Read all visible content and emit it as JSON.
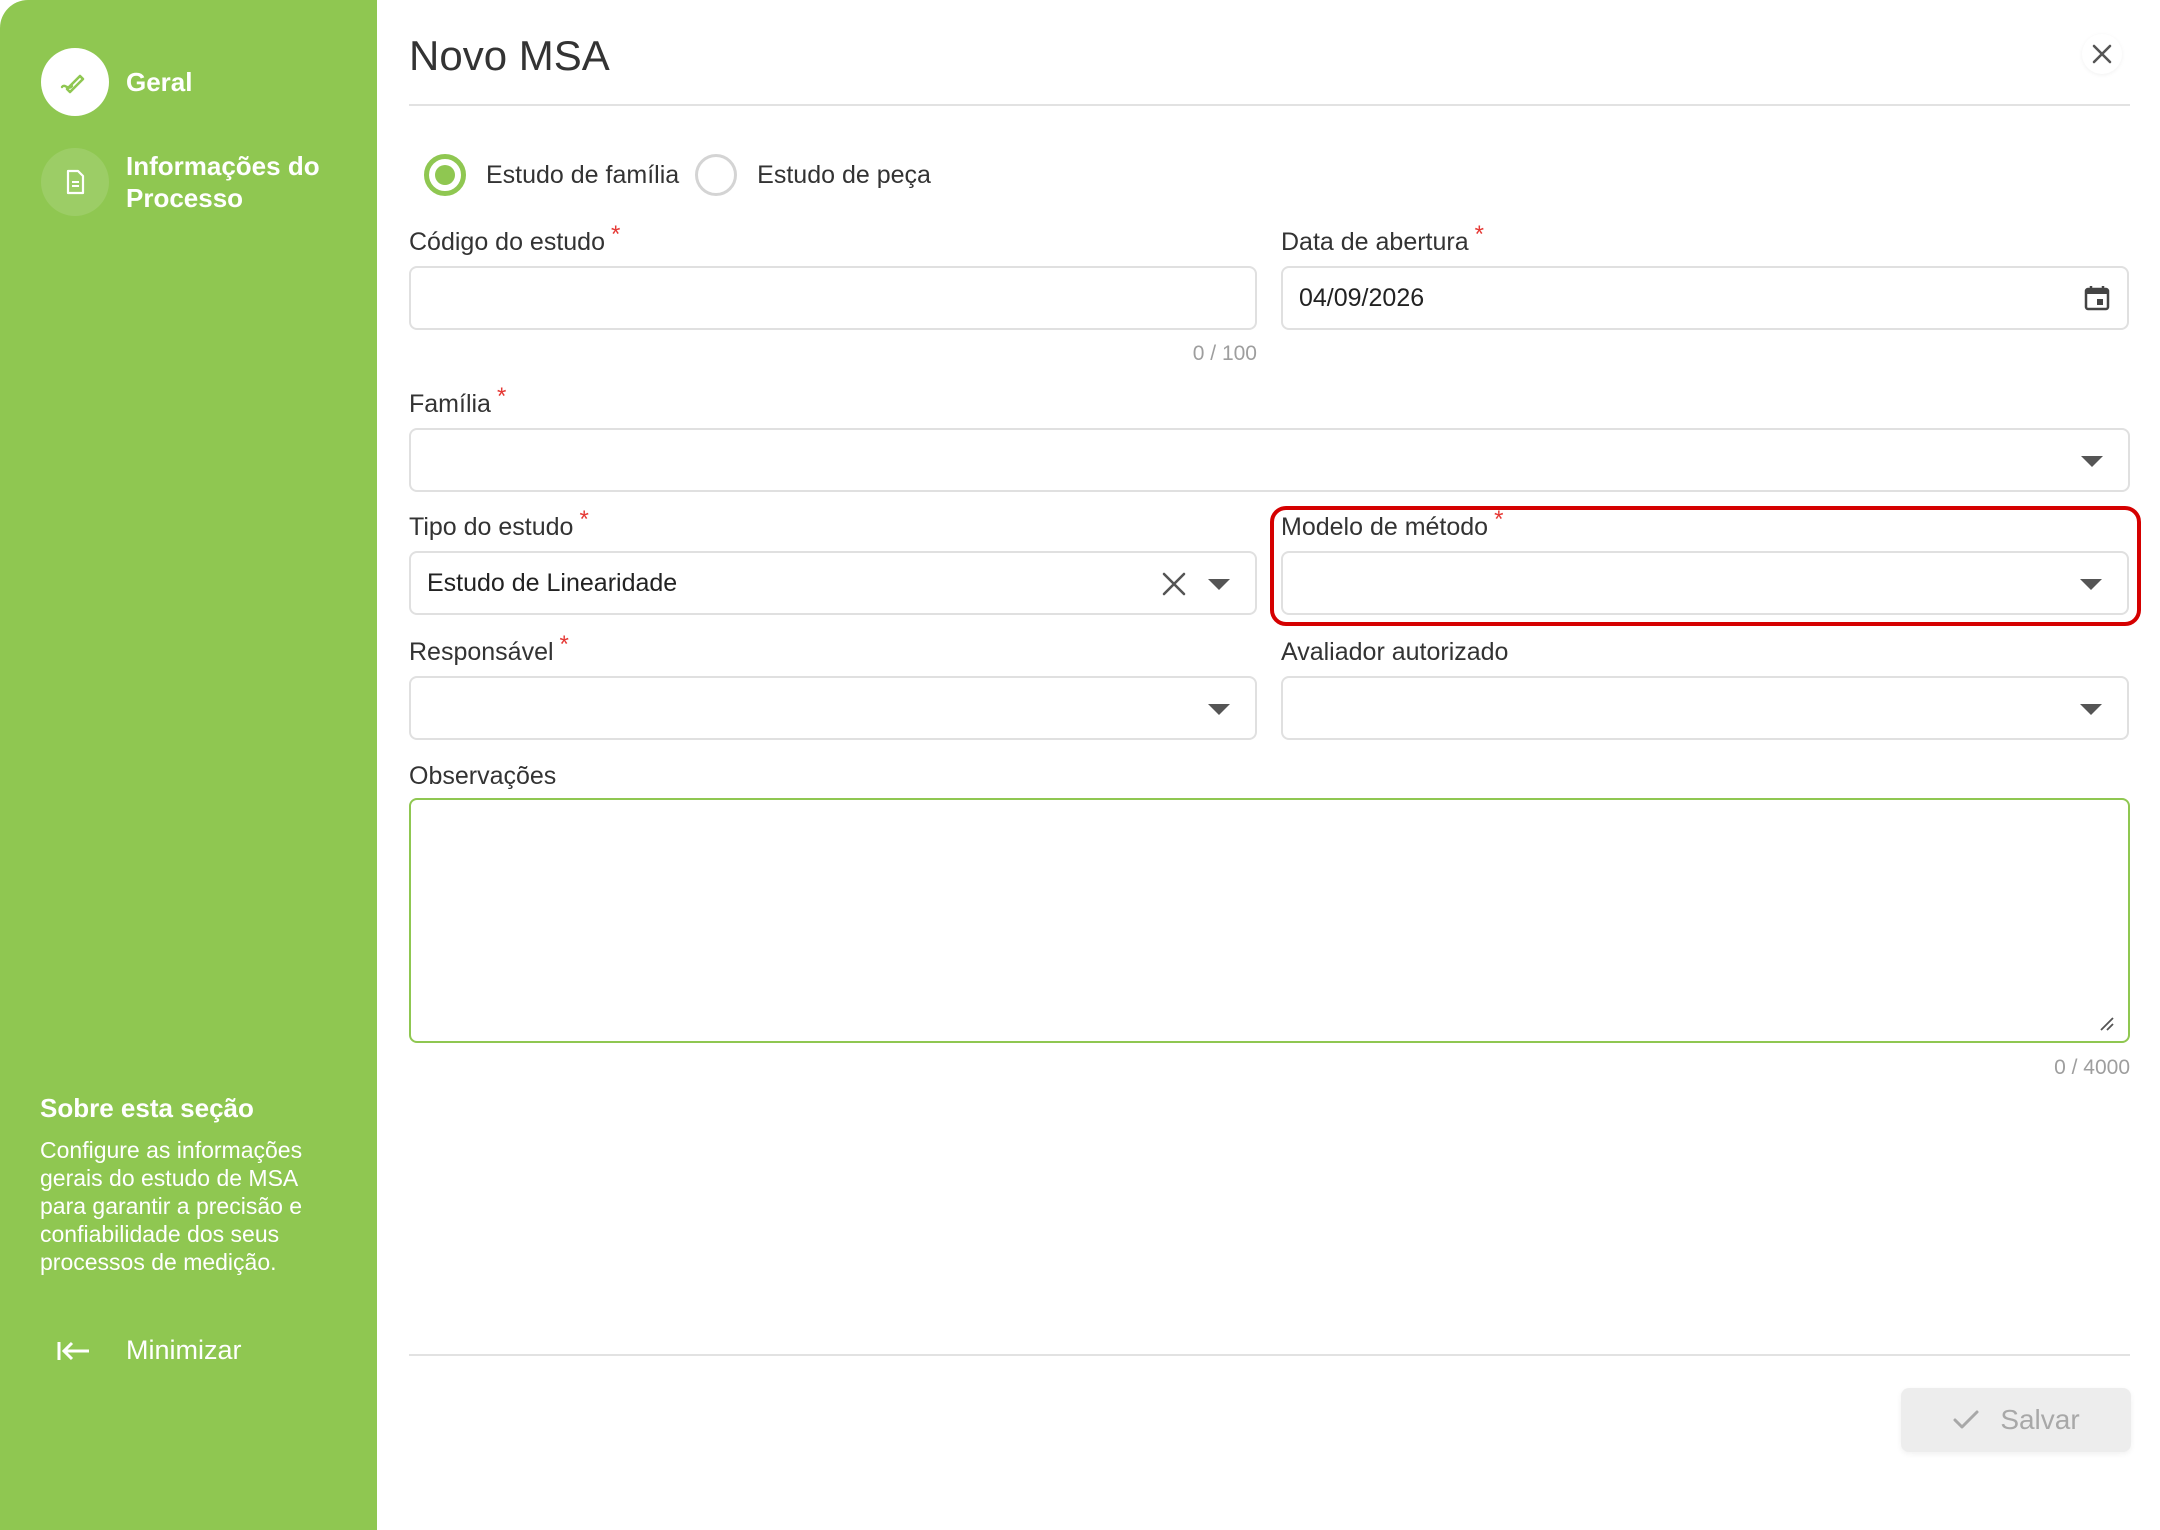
{
  "sidebar": {
    "items": [
      {
        "label": "Geral",
        "icon": "pencil-icon"
      },
      {
        "label": "Informações do Processo",
        "icon": "document-icon"
      }
    ],
    "about_title": "Sobre esta seção",
    "about_text": "Configure as informações gerais do estudo de MSA para garantir a precisão e confiabilidade dos seus processos de medição.",
    "minimize_label": "Minimizar"
  },
  "dialog": {
    "title": "Novo MSA"
  },
  "study_type_radio": {
    "options": [
      {
        "label": "Estudo de família",
        "checked": true
      },
      {
        "label": "Estudo de peça",
        "checked": false
      }
    ]
  },
  "form": {
    "codigo": {
      "label": "Código do estudo",
      "value": "",
      "counter": "0 / 100"
    },
    "data_abertura": {
      "label": "Data de abertura",
      "value": "04/09/2026"
    },
    "familia": {
      "label": "Família",
      "value": ""
    },
    "tipo_estudo": {
      "label": "Tipo do estudo",
      "value": "Estudo de Linearidade"
    },
    "modelo_metodo": {
      "label": "Modelo de método",
      "value": ""
    },
    "responsavel": {
      "label": "Responsável",
      "value": ""
    },
    "avaliador": {
      "label": "Avaliador autorizado",
      "value": ""
    },
    "observacoes": {
      "label": "Observações",
      "value": "",
      "counter": "0 / 4000"
    },
    "required_mark": "*"
  },
  "footer": {
    "save_label": "Salvar"
  },
  "colors": {
    "accent": "#8fc751",
    "required": "#e53935",
    "highlight": "#d50000"
  }
}
